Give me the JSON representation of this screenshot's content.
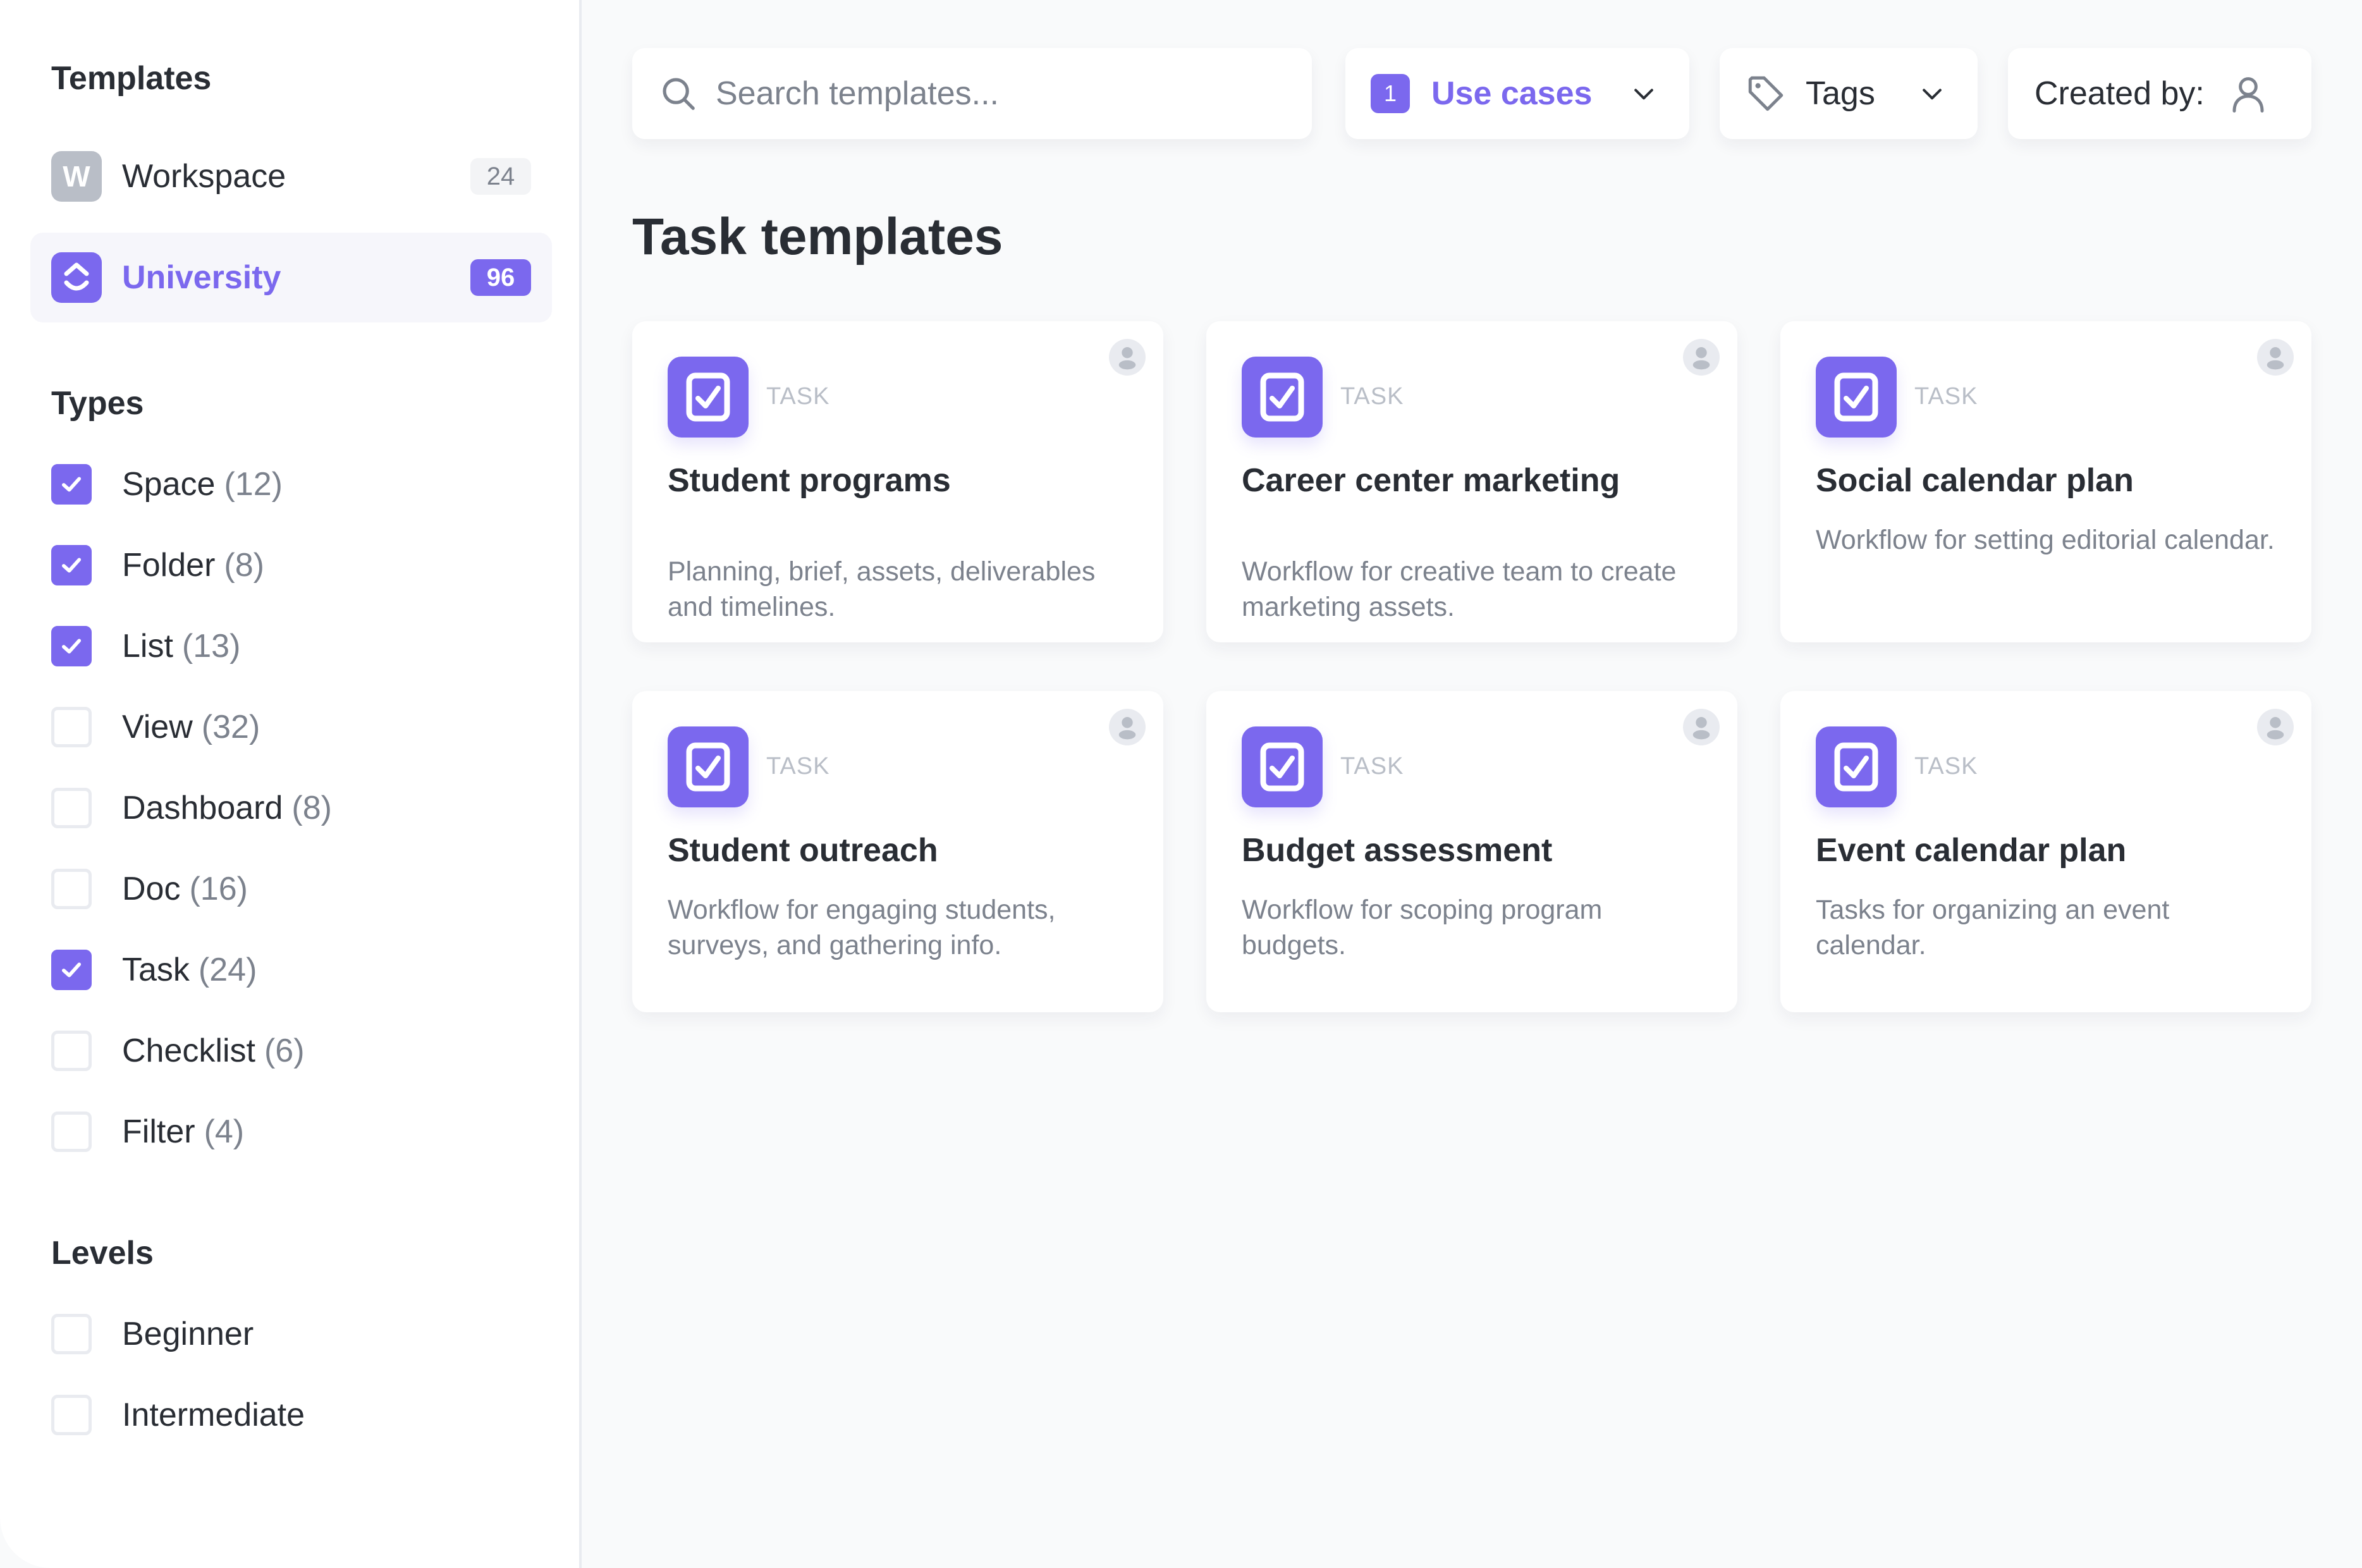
{
  "colors": {
    "accent": "#7b68ee",
    "text": "#292d34",
    "muted": "#7c828d",
    "sidebar_bg": "#ffffff",
    "main_bg": "#f9fafb"
  },
  "sidebar": {
    "templates_title": "Templates",
    "workspaces": [
      {
        "label": "Workspace",
        "initial": "W",
        "count": "24",
        "active": false,
        "icon": "workspace-letter-icon"
      },
      {
        "label": "University",
        "initial": "",
        "count": "96",
        "active": true,
        "icon": "clickup-logo-icon"
      }
    ],
    "types_title": "Types",
    "types": [
      {
        "label": "Space",
        "count": "(12)",
        "checked": true
      },
      {
        "label": "Folder",
        "count": "(8)",
        "checked": true
      },
      {
        "label": "List",
        "count": "(13)",
        "checked": true
      },
      {
        "label": "View",
        "count": "(32)",
        "checked": false
      },
      {
        "label": "Dashboard",
        "count": "(8)",
        "checked": false
      },
      {
        "label": "Doc",
        "count": "(16)",
        "checked": false
      },
      {
        "label": "Task",
        "count": "(24)",
        "checked": true
      },
      {
        "label": "Checklist",
        "count": "(6)",
        "checked": false
      },
      {
        "label": "Filter",
        "count": "(4)",
        "checked": false
      }
    ],
    "levels_title": "Levels",
    "levels": [
      {
        "label": "Beginner",
        "checked": false
      },
      {
        "label": "Intermediate",
        "checked": false
      }
    ]
  },
  "toolbar": {
    "search_placeholder": "Search templates...",
    "search_value": "",
    "use_cases_badge": "1",
    "use_cases_label": "Use cases",
    "tags_label": "Tags",
    "created_by_label": "Created by:"
  },
  "main": {
    "title": "Task templates",
    "cards": [
      {
        "type": "TASK",
        "title": "Student programs",
        "description": "Planning, brief, assets, deliverables and timelines."
      },
      {
        "type": "TASK",
        "title": "Career center marketing",
        "description": "Workflow for creative team to create marketing assets."
      },
      {
        "type": "TASK",
        "title": "Social calendar plan",
        "description": "Workflow for setting editorial calendar."
      },
      {
        "type": "TASK",
        "title": "Student outreach",
        "description": "Workflow for engaging students, surveys, and gathering info."
      },
      {
        "type": "TASK",
        "title": "Budget assessment",
        "description": "Workflow for scoping program budgets."
      },
      {
        "type": "TASK",
        "title": "Event calendar plan",
        "description": "Tasks for organizing an event calendar."
      }
    ]
  }
}
